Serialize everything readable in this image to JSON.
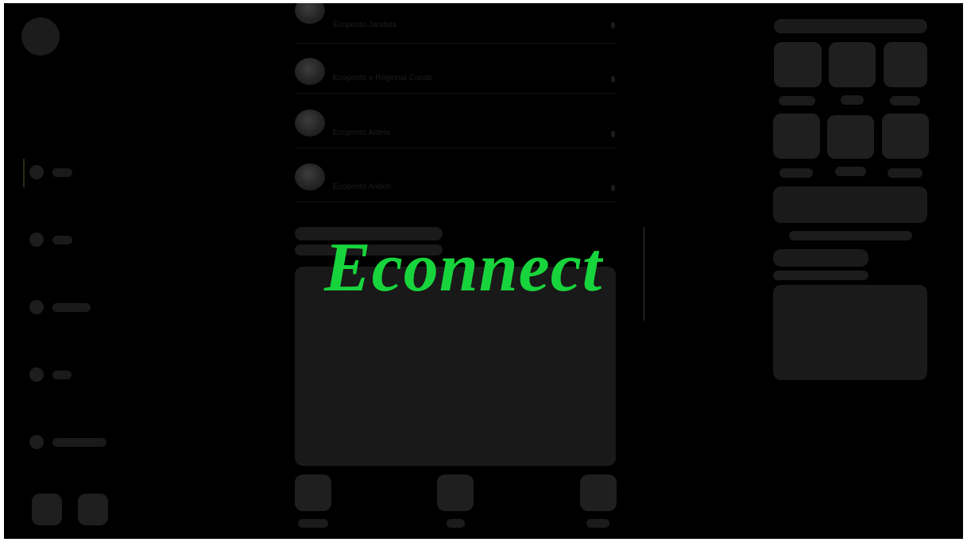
{
  "app": {
    "logo_text": "Econnect",
    "accent_color": "#18d43c"
  },
  "sidebar": {
    "user_name": "",
    "items": [
      {
        "icon": "circle-icon",
        "active": true
      },
      {
        "icon": "circle-icon",
        "active": false
      },
      {
        "icon": "circle-icon",
        "active": false
      },
      {
        "icon": "circle-icon",
        "active": false
      },
      {
        "icon": "circle-icon",
        "active": false
      }
    ]
  },
  "ecopoints": [
    {
      "name": "Ecoponto Jandaia"
    },
    {
      "name": "Ecoponto e Regional Conab"
    },
    {
      "name": "Ecoponto Aldeia"
    },
    {
      "name": "Ecoponto Aridon"
    }
  ]
}
